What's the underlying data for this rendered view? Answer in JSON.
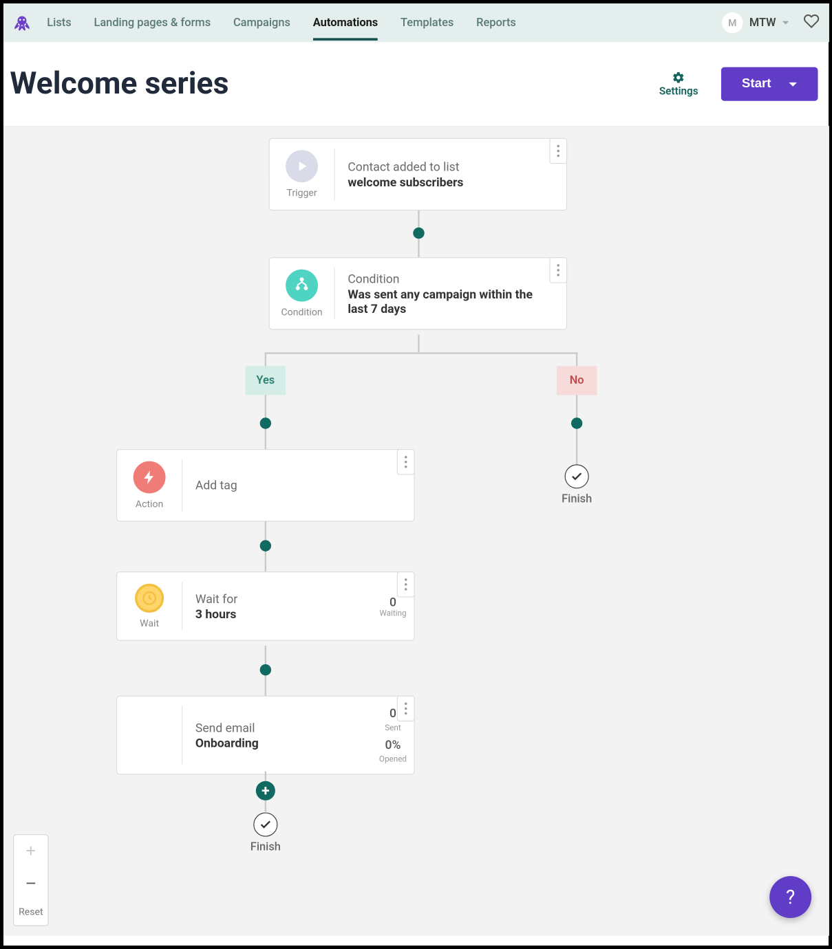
{
  "nav": {
    "items": [
      "Lists",
      "Landing pages & forms",
      "Campaigns",
      "Automations",
      "Templates",
      "Reports"
    ],
    "active_index": 3
  },
  "user": {
    "initial": "M",
    "name": "MTW"
  },
  "header": {
    "title": "Welcome series",
    "settings_label": "Settings",
    "start_label": "Start"
  },
  "nodes": {
    "trigger": {
      "type": "Trigger",
      "line1": "Contact added to list",
      "line2": "welcome subscribers"
    },
    "condition": {
      "type": "Condition",
      "line1": "Condition",
      "line2": "Was sent any campaign within the last 7 days"
    },
    "action": {
      "type": "Action",
      "line1": "Add tag"
    },
    "wait": {
      "type": "Wait",
      "line1": "Wait for",
      "line2": "3 hours",
      "stat_num": "0",
      "stat_lbl": "Waiting"
    },
    "email": {
      "line1": "Send email",
      "line2": "Onboarding",
      "stat1_num": "0",
      "stat1_lbl": "Sent",
      "stat2_num": "0%",
      "stat2_lbl": "Opened"
    }
  },
  "branches": {
    "yes": "Yes",
    "no": "No"
  },
  "finish_label": "Finish",
  "zoom": {
    "reset": "Reset"
  },
  "help": "?"
}
